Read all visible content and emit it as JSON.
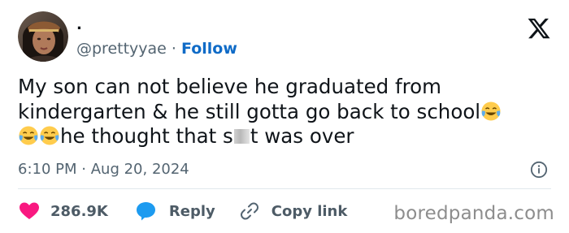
{
  "tweet": {
    "display_name": ".",
    "handle": "@prettyyae",
    "separator": "·",
    "follow_label": "Follow",
    "text": {
      "line1": "My son can not believe he graduated from",
      "line2": "kindergarten & he still gotta go back to school",
      "line3_a": "he thought that s",
      "line3_b": "t was over"
    },
    "emojis": [
      "face-with-tears-of-joy",
      "face-with-tears-of-joy",
      "face-with-tears-of-joy"
    ],
    "time": "6:10 PM",
    "meta_separator": "·",
    "date": "Aug 20, 2024"
  },
  "actions": {
    "likes": "286.9K",
    "reply_label": "Reply",
    "copy_label": "Copy link"
  },
  "watermark": "boredpanda.com",
  "colors": {
    "follow": "#0f6bc7",
    "heart": "#f91880",
    "reply_bubble": "#1d9bf0",
    "muted": "#536471"
  },
  "icons": {
    "brand": "x-logo-icon",
    "info": "info-icon",
    "like": "heart-icon",
    "reply": "speech-bubble-icon",
    "copy": "link-icon"
  }
}
